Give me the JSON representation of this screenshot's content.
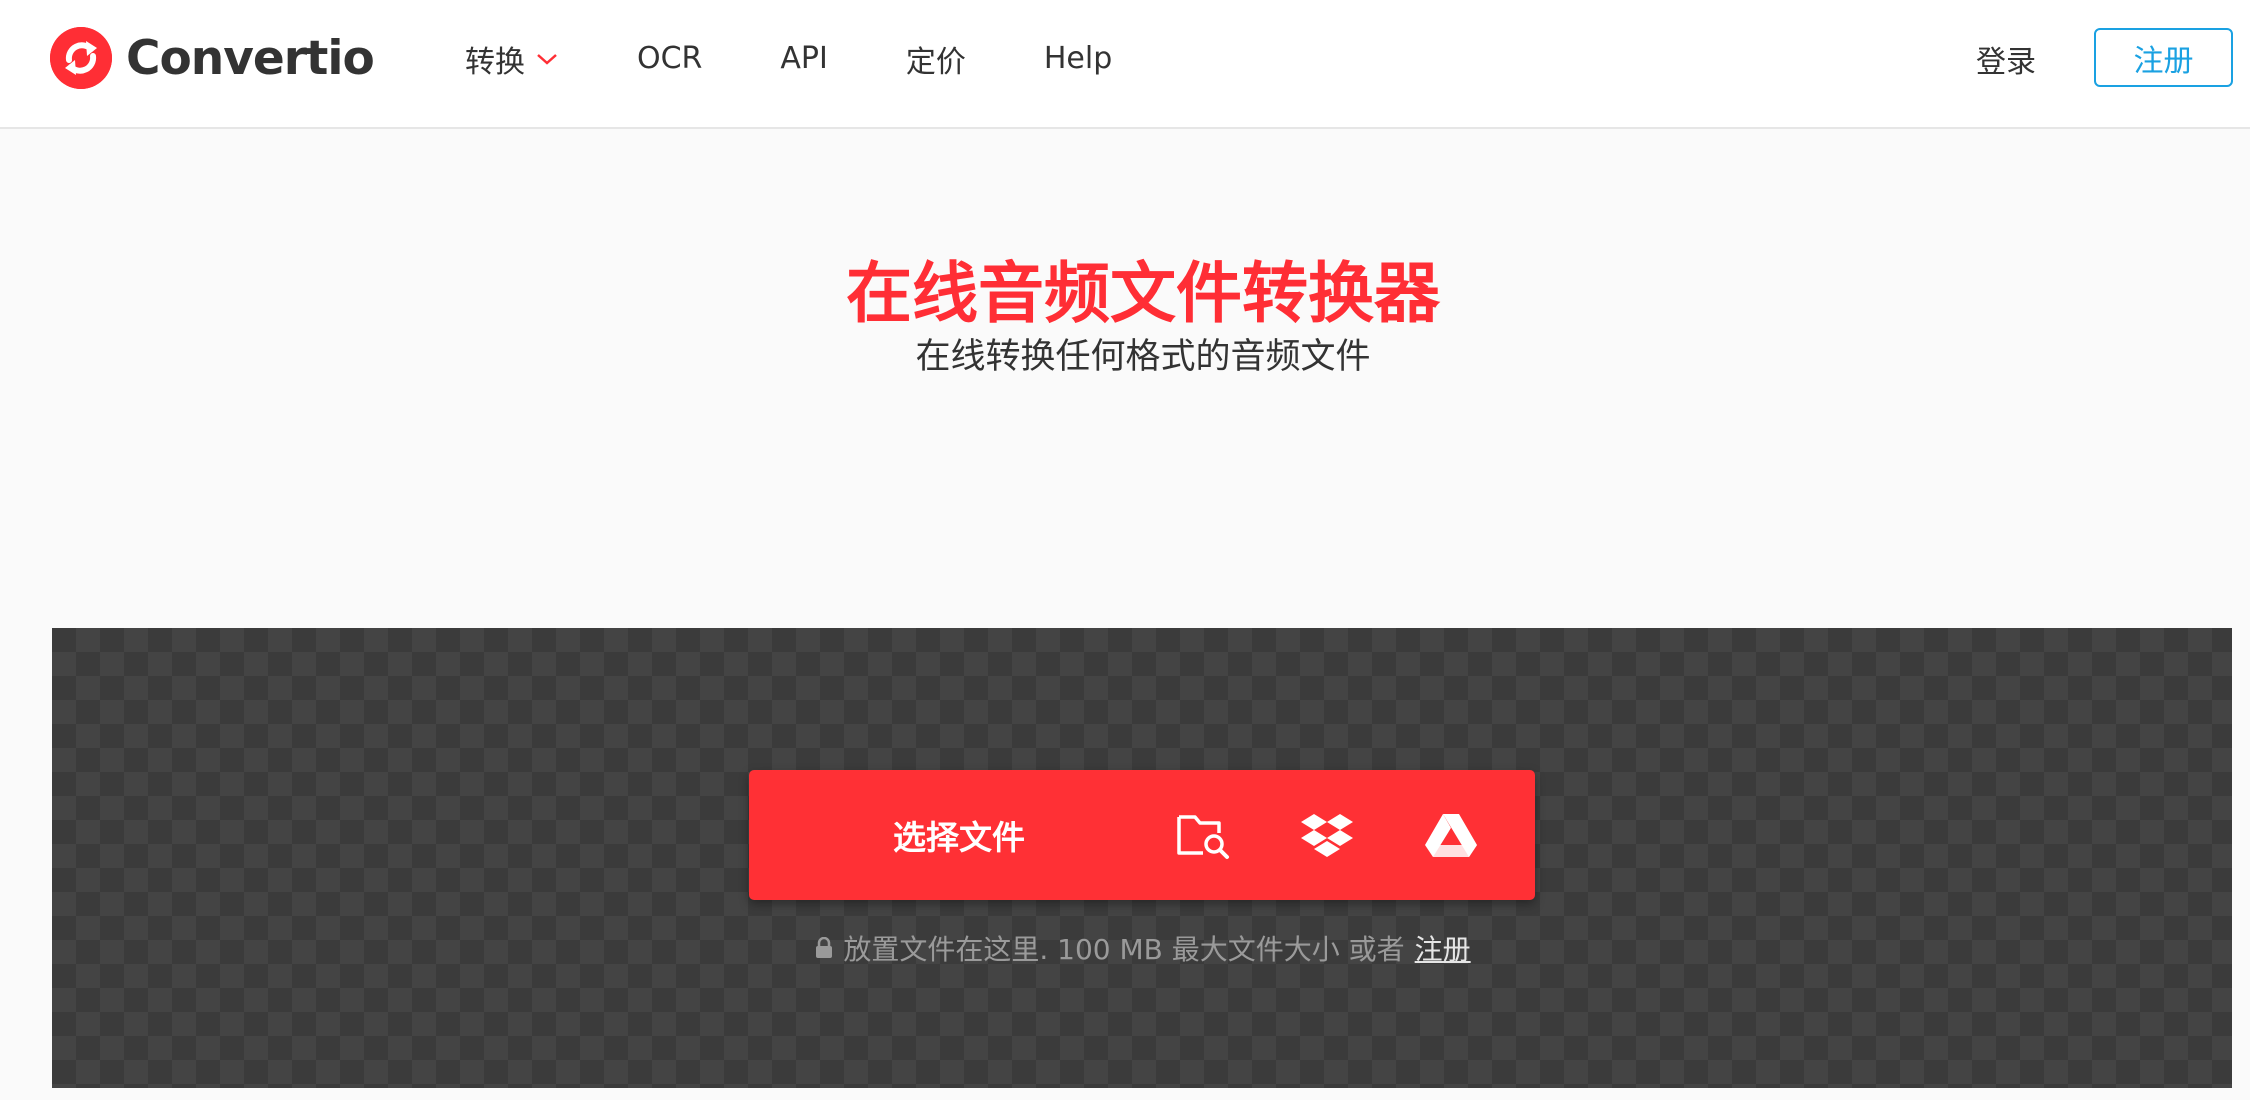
{
  "brand": {
    "name": "Convertio",
    "accent": "#ff2e35"
  },
  "nav": {
    "convert": "转换",
    "ocr": "OCR",
    "api": "API",
    "pricing": "定价",
    "help": "Help"
  },
  "auth": {
    "login": "登录",
    "signup": "注册"
  },
  "hero": {
    "title": "在线音频文件转换器",
    "subtitle": "在线转换任何格式的音频文件"
  },
  "upload": {
    "choose_label": "选择文件",
    "sources": [
      "folder-search-icon",
      "dropbox-icon",
      "google-drive-icon"
    ],
    "hint_text": "放置文件在这里. 100 MB 最大文件大小 或者",
    "hint_link": "注册"
  }
}
